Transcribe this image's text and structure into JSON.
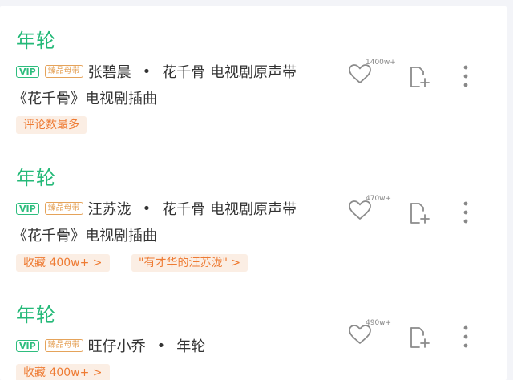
{
  "songs": [
    {
      "title": "年轮",
      "vip_label": "VIP",
      "quality_label": "臻品母带",
      "artist": "张碧晨",
      "separator": "•",
      "album": "花千骨 电视剧原声带",
      "desc": "《花千骨》电视剧插曲",
      "tags": [
        "评论数最多"
      ],
      "like_count": "1400w+"
    },
    {
      "title": "年轮",
      "vip_label": "VIP",
      "quality_label": "臻品母带",
      "artist": "汪苏泷",
      "separator": "•",
      "album": "花千骨 电视剧原声带",
      "desc": "《花千骨》电视剧插曲",
      "tags": [
        "收藏 400w+ >",
        "\"有才华的汪苏泷\" >"
      ],
      "like_count": "470w+"
    },
    {
      "title": "年轮",
      "vip_label": "VIP",
      "quality_label": "臻品母带",
      "artist": "旺仔小乔",
      "separator": "•",
      "album": "年轮",
      "tags": [
        "收藏 400w+ >"
      ],
      "like_count": "490w+"
    }
  ],
  "colors": {
    "title_green": "#24b978",
    "vip_green": "#2ebd7e",
    "quality_gold": "#e5a35a",
    "tag_orange": "#ee7b33",
    "tag_bg": "#fbeee4"
  },
  "icons": {
    "like": "heart-outline-icon",
    "add": "add-to-playlist-icon",
    "more": "vertical-dots-icon"
  }
}
